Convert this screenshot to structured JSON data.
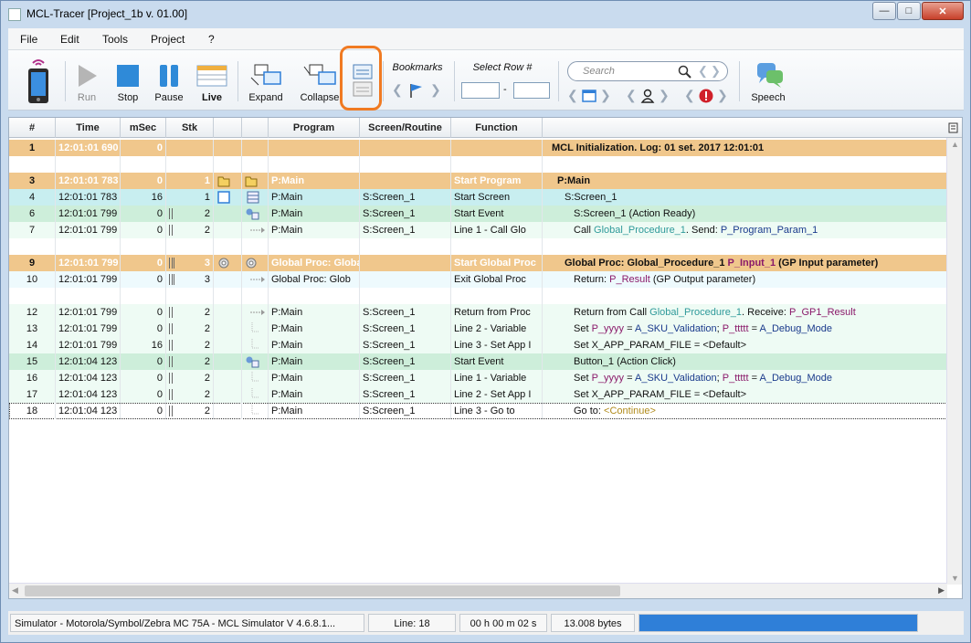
{
  "window": {
    "title": "MCL-Tracer [Project_1b v. 01.00]"
  },
  "menu": [
    "File",
    "Edit",
    "Tools",
    "Project",
    "?"
  ],
  "toolbar": {
    "run": "Run",
    "stop": "Stop",
    "pause": "Pause",
    "live": "Live",
    "expand": "Expand",
    "collapse": "Collapse",
    "bookmarks": "Bookmarks",
    "select_row": "Select Row #",
    "dash": "-",
    "search_placeholder": "Search",
    "speech": "Speech"
  },
  "columns": [
    "#",
    "Time",
    "mSec",
    "Stk",
    "",
    "",
    "Program",
    "Screen/Routine",
    "Function",
    ""
  ],
  "rows": [
    {
      "idx": "1",
      "time": "12:01:01 690",
      "msec": "0",
      "stk": "",
      "prog": "",
      "screen": "",
      "func": "",
      "detail": "MCL Initialization. Log:  01 set. 2017 12:01:01",
      "style": "orange"
    },
    {
      "idx": "",
      "time": "",
      "msec": "",
      "stk": "",
      "prog": "",
      "screen": "",
      "func": "",
      "detail": "",
      "style": "blank"
    },
    {
      "idx": "3",
      "time": "12:01:01 783",
      "msec": "0",
      "stk": "1",
      "prog": "P:Main",
      "screen": "",
      "func": "Start Program",
      "detail": "P:Main",
      "style": "orange"
    },
    {
      "idx": "4",
      "time": "12:01:01 783",
      "msec": "16",
      "stk": "1",
      "prog": "P:Main",
      "screen": "S:Screen_1",
      "func": "Start Screen",
      "detail": "S:Screen_1",
      "style": "cyan"
    },
    {
      "idx": "6",
      "time": "12:01:01 799",
      "msec": "0",
      "stk": "2",
      "prog": "P:Main",
      "screen": "S:Screen_1",
      "func": "Start Event",
      "detail": "S:Screen_1 (Action Ready)",
      "style": "mint"
    },
    {
      "idx": "7",
      "time": "12:01:01 799",
      "msec": "0",
      "stk": "2",
      "prog": "P:Main",
      "screen": "S:Screen_1",
      "func": " Line 1 - Call Glo",
      "detail_parts": [
        {
          "t": "Call "
        },
        {
          "t": "Global_Procedure_1",
          "c": "g"
        },
        {
          "t": ".  Send: "
        },
        {
          "t": "P_Program_Param_1",
          "c": "b"
        }
      ],
      "style": "pale"
    },
    {
      "idx": "",
      "time": "",
      "msec": "",
      "stk": "",
      "prog": "",
      "screen": "",
      "func": "",
      "detail": "",
      "style": "blank"
    },
    {
      "idx": "9",
      "time": "12:01:01 799",
      "msec": "0",
      "stk": "3",
      "prog": "Global Proc: Global",
      "screen": "",
      "func": "Start Global Proc",
      "detail_parts": [
        {
          "t": "Global Proc: Global_Procedure_1 "
        },
        {
          "t": "P_Input_1",
          "c": "p"
        },
        {
          "t": " (GP Input parameter)"
        }
      ],
      "style": "orange"
    },
    {
      "idx": "10",
      "time": "12:01:01 799",
      "msec": "0",
      "stk": "3",
      "prog": "Global Proc: Glob",
      "screen": "",
      "func": "Exit Global Proc",
      "detail_parts": [
        {
          "t": "Return: "
        },
        {
          "t": "P_Result",
          "c": "p"
        },
        {
          "t": " (GP Output parameter)"
        }
      ],
      "style": "paleblue"
    },
    {
      "idx": "",
      "time": "",
      "msec": "",
      "stk": "",
      "prog": "",
      "screen": "",
      "func": "",
      "detail": "",
      "style": "blank"
    },
    {
      "idx": "12",
      "time": "12:01:01 799",
      "msec": "0",
      "stk": "2",
      "prog": "P:Main",
      "screen": "S:Screen_1",
      "func": " Return from Proc",
      "detail_parts": [
        {
          "t": "Return from Call "
        },
        {
          "t": "Global_Procedure_1",
          "c": "g"
        },
        {
          "t": ".  Receive: "
        },
        {
          "t": "P_GP1_Result",
          "c": "p"
        }
      ],
      "style": "pale"
    },
    {
      "idx": "13",
      "time": "12:01:01 799",
      "msec": "0",
      "stk": "2",
      "prog": "P:Main",
      "screen": "S:Screen_1",
      "func": " Line 2 - Variable",
      "detail_parts": [
        {
          "t": "Set "
        },
        {
          "t": "P_yyyy",
          "c": "p"
        },
        {
          "t": " = "
        },
        {
          "t": "A_SKU_Validation",
          "c": "b"
        },
        {
          "t": "; "
        },
        {
          "t": "P_ttttt",
          "c": "p"
        },
        {
          "t": " = "
        },
        {
          "t": "A_Debug_Mode",
          "c": "b"
        }
      ],
      "style": "pale"
    },
    {
      "idx": "14",
      "time": "12:01:01 799",
      "msec": "16",
      "stk": "2",
      "prog": "P:Main",
      "screen": "S:Screen_1",
      "func": " Line 3 - Set App I",
      "detail": "Set X_APP_PARAM_FILE = <Default>",
      "style": "pale"
    },
    {
      "idx": "15",
      "time": "12:01:04 123",
      "msec": "0",
      "stk": "2",
      "prog": "P:Main",
      "screen": "S:Screen_1",
      "func": "Start Event",
      "detail": "Button_1 (Action Click)",
      "style": "mint"
    },
    {
      "idx": "16",
      "time": "12:01:04 123",
      "msec": "0",
      "stk": "2",
      "prog": "P:Main",
      "screen": "S:Screen_1",
      "func": " Line 1 - Variable",
      "detail_parts": [
        {
          "t": "Set "
        },
        {
          "t": "P_yyyy",
          "c": "p"
        },
        {
          "t": " = "
        },
        {
          "t": "A_SKU_Validation",
          "c": "b"
        },
        {
          "t": "; "
        },
        {
          "t": "P_ttttt",
          "c": "p"
        },
        {
          "t": " = "
        },
        {
          "t": "A_Debug_Mode",
          "c": "b"
        }
      ],
      "style": "pale"
    },
    {
      "idx": "17",
      "time": "12:01:04 123",
      "msec": "0",
      "stk": "2",
      "prog": "P:Main",
      "screen": "S:Screen_1",
      "func": " Line 2 - Set App I",
      "detail": "Set X_APP_PARAM_FILE = <Default>",
      "style": "pale"
    },
    {
      "idx": "18",
      "time": "12:01:04 123",
      "msec": "0",
      "stk": "2",
      "prog": "P:Main",
      "screen": "S:Screen_1",
      "func": " Line 3 - Go to",
      "detail_parts": [
        {
          "t": "Go to: "
        },
        {
          "t": "<Continue>",
          "c": "y"
        }
      ],
      "style": "selected"
    }
  ],
  "statusbar": {
    "simulator": "Simulator - Motorola/Symbol/Zebra MC 75A - MCL Simulator V 4.6.8.1...",
    "line": "Line: 18",
    "elapsed": "00 h 00 m 02 s",
    "bytes": "13.008 bytes",
    "progress": 1.0
  },
  "colors": {
    "highlight": "#f07a22",
    "orange_row": "#f0c78c",
    "progress": "#2f7fd8"
  }
}
